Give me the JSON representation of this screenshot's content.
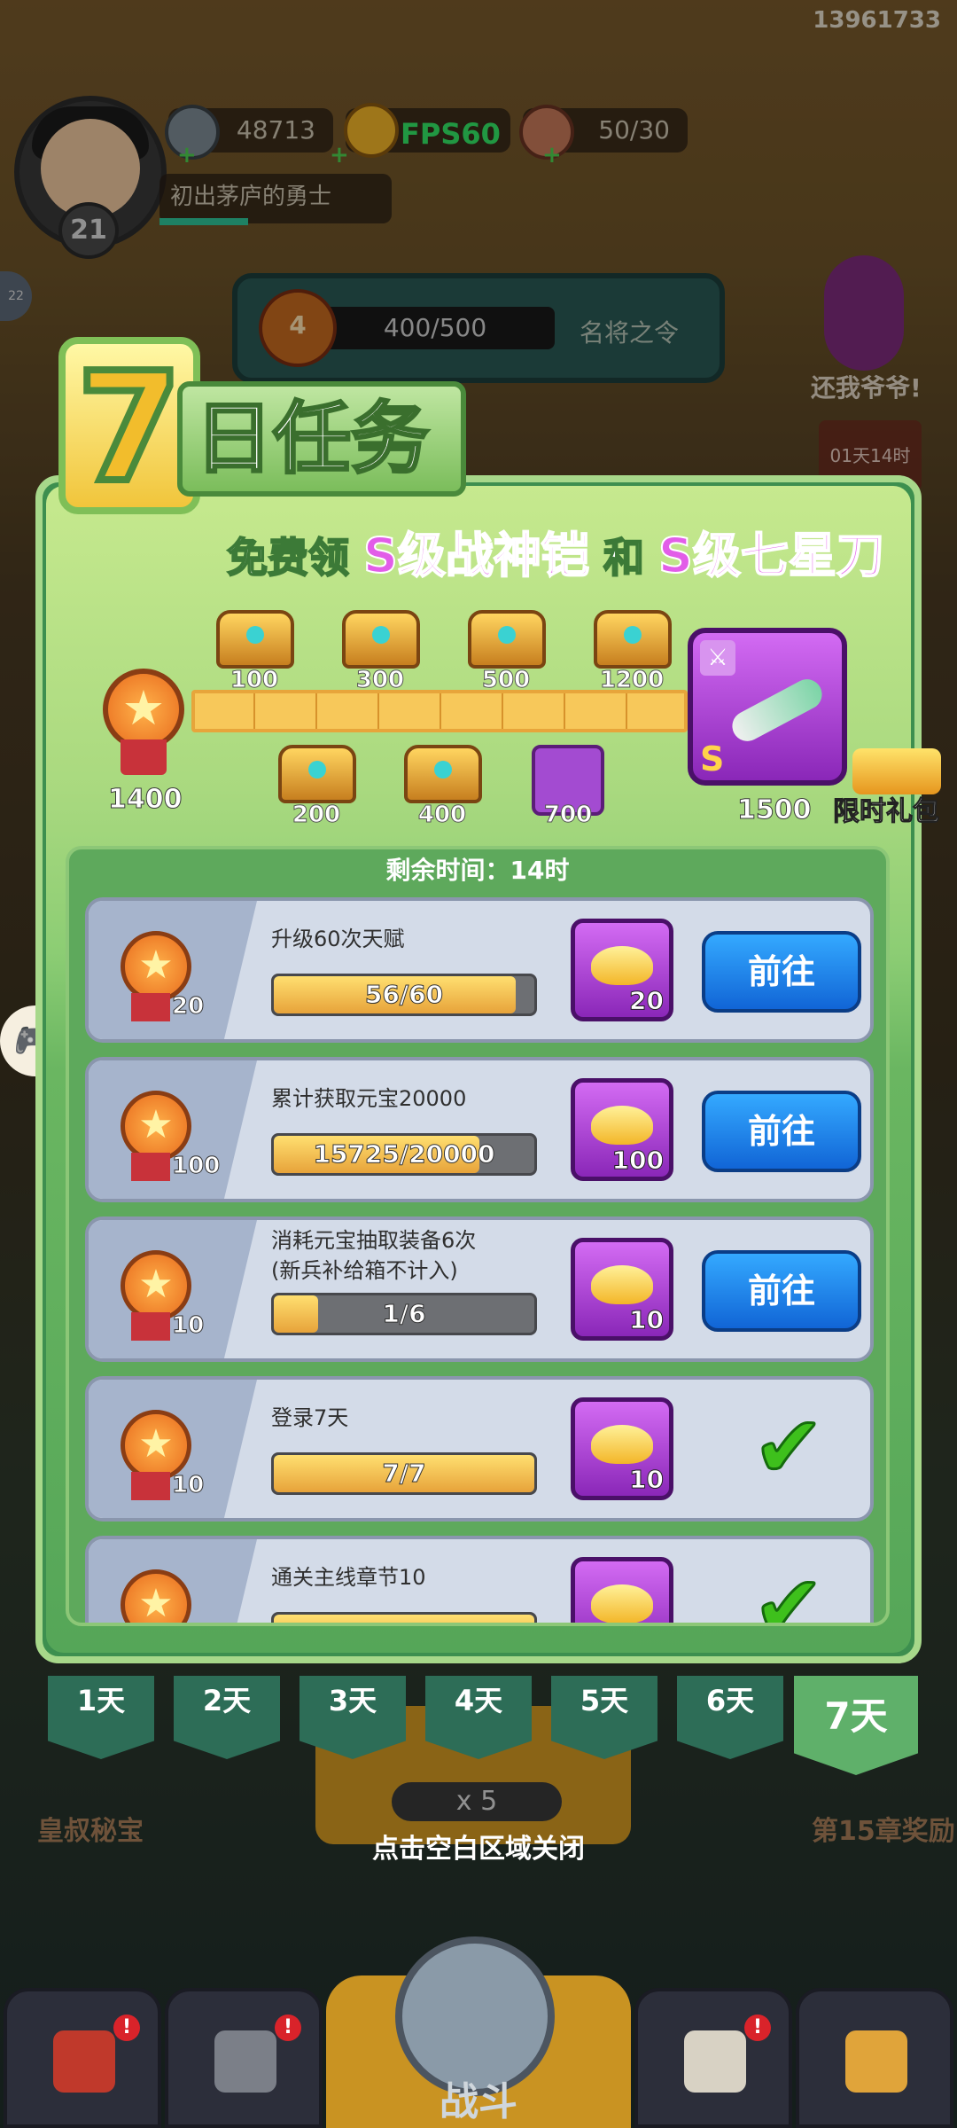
{
  "user_id": "13961733",
  "hud": {
    "coins": "48713",
    "fps": "FPS60",
    "stamina": "50/30",
    "player_level": "21",
    "player_title": "初出茅庐的勇士",
    "mingjiang_level": "4",
    "mingjiang_progress": "400/500",
    "mingjiang_label": "名将之令",
    "side_label_top": "还我爷爷!",
    "side_badge": "22",
    "right_timer": "01天14时"
  },
  "panel": {
    "title_number": "7",
    "title_text": "日任务",
    "subtitle_prefix": "免费领",
    "subtitle_item1": "S级战神铠",
    "subtitle_mid": "和",
    "subtitle_item2": "S级七星刀",
    "progress_current": "1400",
    "progress_max": 1500,
    "progress_value": 1400,
    "milestones_top": [
      "100",
      "300",
      "500",
      "1200"
    ],
    "milestones_bottom": [
      "200",
      "400",
      "700"
    ],
    "final_reward": "1500",
    "final_reward_tag": "S",
    "gift_label": "限时礼包",
    "remaining_time": "剩余时间：14时"
  },
  "tasks": [
    {
      "name": "升级60次天赋",
      "medal": "20",
      "progress": "56/60",
      "fraction": 0.933,
      "reward": "20",
      "action": "前往",
      "done": false
    },
    {
      "name": "累计获取元宝20000",
      "medal": "100",
      "progress": "15725/20000",
      "fraction": 0.786,
      "reward": "100",
      "action": "前往",
      "done": false
    },
    {
      "name": "消耗元宝抽取装备6次\n(新兵补给箱不计入)",
      "medal": "10",
      "progress": "1/6",
      "fraction": 0.167,
      "reward": "10",
      "action": "前往",
      "done": false
    },
    {
      "name": "登录7天",
      "medal": "10",
      "progress": "7/7",
      "fraction": 1.0,
      "reward": "10",
      "action": "",
      "done": true
    },
    {
      "name": "通关主线章节10",
      "medal": "",
      "progress": "",
      "fraction": 1.0,
      "reward": "",
      "action": "",
      "done": true
    }
  ],
  "day_tabs": [
    "1天",
    "2天",
    "3天",
    "4天",
    "5天",
    "6天",
    "7天"
  ],
  "active_day": "7天",
  "background": {
    "left_label": "皇叔秘宝",
    "right_label": "第15章奖励",
    "cost": "x 5",
    "close_hint": "点击空白区域关闭",
    "fight_label": "战斗",
    "nav_badge": "!"
  },
  "colors": {
    "panel_green": "#3d8f4f",
    "go_button_blue": "#1e86f0",
    "reward_purple": "#a34bd1",
    "check_green": "#3ec01c",
    "title_pink": "#e25de8"
  }
}
